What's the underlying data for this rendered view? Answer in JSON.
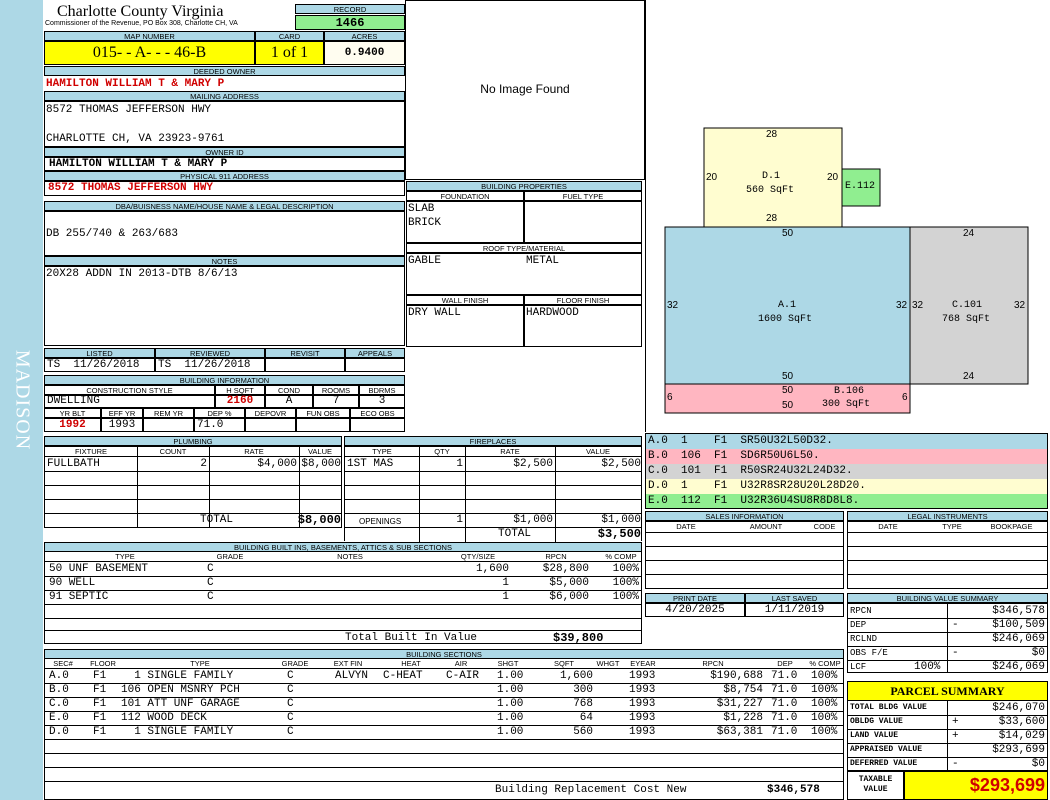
{
  "sidebar": {
    "district": "MADISON"
  },
  "header": {
    "county": "Charlotte County Virginia",
    "commissioner": "Commissioner of the Revenue, PO Box 308, Charlotte CH, VA",
    "record_label": "RECORD",
    "record": "1466",
    "map_label": "MAP NUMBER",
    "map_number": "015- - A- - - 46-B",
    "card_label": "CARD",
    "card": "1 of 1",
    "acres_label": "ACRES",
    "acres": "0.9400"
  },
  "owner": {
    "deeded_label": "DEEDED OWNER",
    "deeded": "HAMILTON WILLIAM T & MARY P",
    "mailing_label": "MAILING ADDRESS",
    "mail_line1": "8572 THOMAS JEFFERSON HWY",
    "mail_line2": "CHARLOTTE CH, VA 23923-9761",
    "ownerid_label": "OWNER ID",
    "ownerid": "HAMILTON WILLIAM T & MARY P",
    "physical_label": "PHYSICAL 911 ADDRESS",
    "physical": "8572 THOMAS JEFFERSON HWY",
    "legal_label": "DBA/BUISNESS NAME/HOUSE NAME & LEGAL DESCRIPTION",
    "legal": "DB 255/740 & 263/683",
    "notes_label": "NOTES",
    "notes": "20X28 ADDN IN 2013-DTB 8/6/13"
  },
  "image": {
    "placeholder": "No Image Found"
  },
  "props": {
    "title": "BUILDING PROPERTIES",
    "foundation_label": "FOUNDATION",
    "fuel_label": "FUEL TYPE",
    "foundation1": "SLAB",
    "foundation2": "BRICK",
    "roof_label": "ROOF TYPE/MATERIAL",
    "roof_type": "GABLE",
    "roof_mat": "METAL",
    "wall_label": "WALL FINISH",
    "floor_label": "FLOOR FINISH",
    "wall": "DRY WALL",
    "floor": "HARDWOOD"
  },
  "dates": {
    "listed_label": "LISTED",
    "reviewed_label": "REVIEWED",
    "revisit_label": "REVISIT",
    "appeals_label": "APPEALS",
    "listed": "TS  11/26/2018",
    "reviewed": "TS  11/26/2018"
  },
  "bldg": {
    "title": "BUILDING INFORMATION",
    "style_label": "CONSTRUCTION STYLE",
    "hsqft_label": "H SQFT",
    "cond_label": "COND",
    "rooms_label": "ROOMS",
    "bdrms_label": "BDRMS",
    "style": "DWELLING",
    "hsqft": "2160",
    "cond": "A",
    "rooms": "7",
    "bdrms": "3",
    "yrblt_label": "YR BLT",
    "effyr_label": "EFF YR",
    "remyr_label": "REM YR",
    "dep_label": "DEP %",
    "depovr_label": "DEPOVR",
    "funobs_label": "FUN OBS",
    "ecoobs_label": "ECO OBS",
    "yrblt": "1992",
    "effyr": "1993",
    "dep": "71.0"
  },
  "plumbing": {
    "title": "PLUMBING",
    "h_fixture": "FIXTURE",
    "h_count": "COUNT",
    "h_rate": "RATE",
    "h_value": "VALUE",
    "fixture": "FULLBATH",
    "count": "2",
    "rate": "$4,000",
    "value": "$8,000",
    "total_label": "TOTAL",
    "total": "$8,000"
  },
  "fireplaces": {
    "title": "FIREPLACES",
    "h_type": "TYPE",
    "h_qty": "QTY",
    "h_rate": "RATE",
    "h_value": "VALUE",
    "type": "1ST MAS",
    "qty": "1",
    "rate": "$2,500",
    "value": "$2,500",
    "openings_label": "OPENINGS",
    "op_qty": "1",
    "op_rate": "$1,000",
    "op_value": "$1,000",
    "total_label": "TOTAL",
    "total": "$3,500"
  },
  "builtins": {
    "title": "BUILDING BUILT INS, BASEMENTS, ATTICS & SUB SECTIONS",
    "h_type": "TYPE",
    "h_grade": "GRADE",
    "h_notes": "NOTES",
    "h_qty": "QTY/SIZE",
    "h_rpcn": "RPCN",
    "h_comp": "% COMP",
    "rows": [
      {
        "type": "50 UNF BASEMENT",
        "grade": "C",
        "qty": "1,600",
        "rpcn": "$28,800",
        "comp": "100%"
      },
      {
        "type": "90 WELL",
        "grade": "C",
        "qty": "1",
        "rpcn": "$5,000",
        "comp": "100%"
      },
      {
        "type": "91 SEPTIC",
        "grade": "C",
        "qty": "1",
        "rpcn": "$6,000",
        "comp": "100%"
      }
    ],
    "total_label": "Total Built In Value",
    "total": "$39,800"
  },
  "sections": {
    "title": "BUILDING SECTIONS",
    "h_sec": "SEC#",
    "h_floor": "FLOOR",
    "h_type": "TYPE",
    "h_grade": "GRADE",
    "h_extfin": "EXT FIN",
    "h_heat": "HEAT",
    "h_air": "AIR",
    "h_shgt": "SHGT",
    "h_sqft": "SQFT",
    "h_whgt": "WHGT",
    "h_eyear": "EYEAR",
    "h_rpcn": "RPCN",
    "h_dep": "DEP",
    "h_comp": "% COMP",
    "rows": [
      {
        "sec": "A.0",
        "floor": "F1",
        "type": "  1 SINGLE FAMILY",
        "grade": "C",
        "extfin": "ALVYN",
        "heat": "C-HEAT",
        "air": "C-AIR",
        "shgt": "1.00",
        "sqft": "1,600",
        "eyear": "1993",
        "rpcn": "$190,688",
        "dep": "71.0",
        "comp": "100%"
      },
      {
        "sec": "B.0",
        "floor": "F1",
        "type": "106 OPEN MSNRY PCH",
        "grade": "C",
        "extfin": "",
        "heat": "",
        "air": "",
        "shgt": "1.00",
        "sqft": "300",
        "eyear": "1993",
        "rpcn": "$8,754",
        "dep": "71.0",
        "comp": "100%"
      },
      {
        "sec": "C.0",
        "floor": "F1",
        "type": "101 ATT UNF GARAGE",
        "grade": "C",
        "extfin": "",
        "heat": "",
        "air": "",
        "shgt": "1.00",
        "sqft": "768",
        "eyear": "1993",
        "rpcn": "$31,227",
        "dep": "71.0",
        "comp": "100%"
      },
      {
        "sec": "E.0",
        "floor": "F1",
        "type": "112 WOOD DECK",
        "grade": "C",
        "extfin": "",
        "heat": "",
        "air": "",
        "shgt": "1.00",
        "sqft": "64",
        "eyear": "1993",
        "rpcn": "$1,228",
        "dep": "71.0",
        "comp": "100%"
      },
      {
        "sec": "D.0",
        "floor": "F1",
        "type": "  1 SINGLE FAMILY",
        "grade": "C",
        "extfin": "",
        "heat": "",
        "air": "",
        "shgt": "1.00",
        "sqft": "560",
        "eyear": "1993",
        "rpcn": "$63,381",
        "dep": "71.0",
        "comp": "100%"
      }
    ],
    "total_label": "Building Replacement Cost New",
    "total": "$346,578"
  },
  "sketch": {
    "areas": [
      {
        "id": "D.1",
        "sqft": "560 SqFt",
        "top": "28",
        "bottom": "28",
        "left": "20",
        "right": "20",
        "color": "#fffdd0"
      },
      {
        "id": "E.112",
        "color": "#90ee90"
      },
      {
        "id": "A.1",
        "sqft": "1600 SqFt",
        "top": "50",
        "bottom": "50",
        "left": "32",
        "right": "32",
        "color": "#add8e6"
      },
      {
        "id": "C.101",
        "sqft": "768 SqFt",
        "top": "24",
        "bottom": "24",
        "left": "32",
        "right": "32",
        "color": "#d3d3d3"
      },
      {
        "id": "B.106",
        "sqft": "300 SqFt",
        "top": "50",
        "bottom": "50",
        "left": "6",
        "right": "6",
        "color": "#ffb6c1"
      }
    ]
  },
  "legend": [
    {
      "code": "A.0  1    F1  SR50U32L50D32.",
      "color": "#add8e6"
    },
    {
      "code": "B.0  106  F1  SD6R50U6L50.",
      "color": "#ffb6c1"
    },
    {
      "code": "C.0  101  F1  R50SR24U32L24D32.",
      "color": "#d3d3d3"
    },
    {
      "code": "D.0  1    F1  U32R8SR28U20L28D20.",
      "color": "#fffdd0"
    },
    {
      "code": "E.0  112  F1  U32R36U4SU8R8D8L8.",
      "color": "#90ee90"
    }
  ],
  "sales": {
    "title": "SALES INFORMATION",
    "h_date": "DATE",
    "h_amount": "AMOUNT",
    "h_code": "CODE"
  },
  "legal_inst": {
    "title": "LEGAL INSTRUMENTS",
    "h_date": "DATE",
    "h_type": "TYPE",
    "h_book": "BOOKPAGE"
  },
  "print": {
    "print_label": "PRINT DATE",
    "saved_label": "LAST SAVED",
    "print_date": "4/20/2025",
    "last_saved": "1/11/2019"
  },
  "summary": {
    "title": "BUILDING VALUE SUMMARY",
    "rpcn_label": "RPCN",
    "rpcn": "$346,578",
    "dep_label": "DEP",
    "dep_sign": "-",
    "dep": "$100,509",
    "rclnd_label": "RCLND",
    "rclnd": "$246,069",
    "obs_label": "OBS F/E",
    "obs_sign": "-",
    "obs": "$0",
    "lcf_label": "LCF",
    "lcf_pct": "100%",
    "lcf": "$246,069"
  },
  "parcel": {
    "title": "PARCEL SUMMARY",
    "tbv_label": "TOTAL BLDG VALUE",
    "tbv": "$246,070",
    "obldg_label": "OBLDG VALUE",
    "obldg_sign": "+",
    "obldg": "$33,600",
    "land_label": "LAND VALUE",
    "land_sign": "+",
    "land": "$14,029",
    "appraised_label": "APPRAISED VALUE",
    "appraised": "$293,699",
    "deferred_label": "DEFERRED VALUE",
    "deferred_sign": "-",
    "deferred": "$0",
    "taxable_label1": "TAXABLE",
    "taxable_label2": "VALUE",
    "taxable": "$293,699"
  }
}
